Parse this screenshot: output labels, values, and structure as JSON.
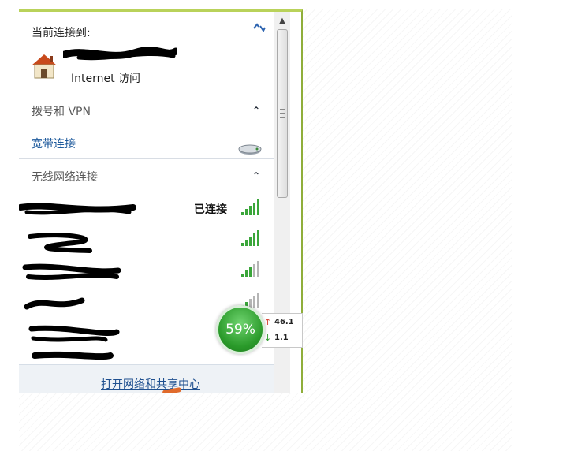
{
  "current_connection": {
    "heading": "当前连接到:",
    "access_label": "Internet 访问"
  },
  "dialup": {
    "heading": "拨号和 VPN",
    "broadband_label": "宽带连接"
  },
  "wireless": {
    "heading": "无线网络连接",
    "connected_label": "已连接"
  },
  "footer": {
    "link_label": "打开网络和共享中心"
  },
  "speed_meter": {
    "percent": "59%",
    "upload": "46.1",
    "download": "1.1"
  },
  "icons": {
    "refresh": "refresh-icon",
    "house": "house-network-icon",
    "broadband": "modem-icon",
    "signal": "wifi-signal-icon",
    "collapse": "chevron-up-icon"
  },
  "colors": {
    "link": "#1e5a9c",
    "panel_border": "#8fae3a",
    "signal_green": "#3aa63a",
    "speed_green": "#2a9a2a"
  }
}
